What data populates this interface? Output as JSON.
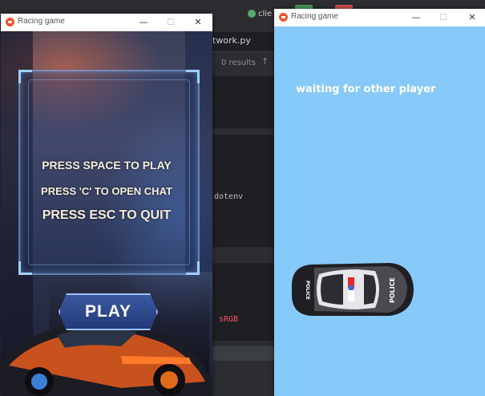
{
  "ide": {
    "tab_label": "twork.py",
    "find_results": "0 results",
    "find_arrow": "↑",
    "code_dotenv": "dotenv",
    "code_srgb": "sRGB",
    "run_config": "clie"
  },
  "left_window": {
    "title": "Racing game",
    "controls": {
      "minimize": "—",
      "maximize": "☐",
      "close": "✕"
    },
    "menu": {
      "line1": "PRESS SPACE TO PLAY",
      "line2": "PRESS 'C' TO OPEN CHAT",
      "line3": "PRESS ESC TO QUIT",
      "play_button": "PLAY"
    }
  },
  "right_window": {
    "title": "Racing game",
    "controls": {
      "minimize": "—",
      "maximize": "☐",
      "close": "✕"
    },
    "status_text": "waiting for other player",
    "car_label_front": "POLICE",
    "car_label_back": "POLICE",
    "background_color": "#87c9f8"
  },
  "icons": {
    "window_icon": "pygame-icon",
    "play_icon": "none"
  }
}
